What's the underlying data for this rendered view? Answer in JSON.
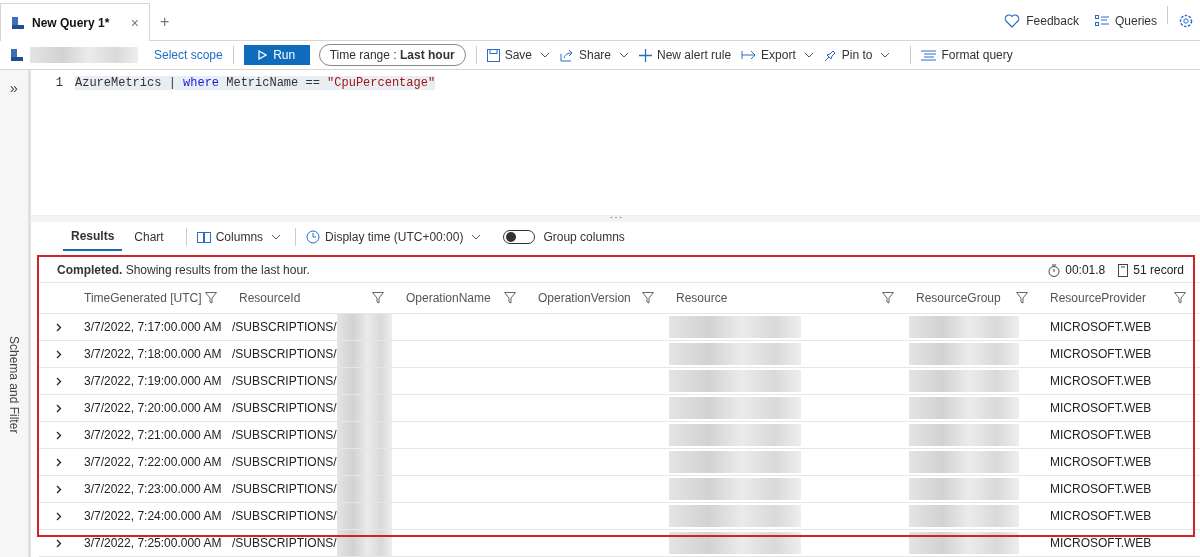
{
  "tabs": [
    {
      "label": "New Query 1*",
      "selected": true,
      "close": "×"
    }
  ],
  "new_tab": "+",
  "header_links": [
    {
      "kind": "feedback",
      "label": "Feedback"
    },
    {
      "kind": "queries",
      "label": "Queries"
    }
  ],
  "toolbar": {
    "scope_link": "Select scope",
    "run": "Run",
    "time_range": {
      "label": "Time range :",
      "value": "Last hour"
    },
    "actions": [
      {
        "kind": "save",
        "label": "Save",
        "dropdown": true
      },
      {
        "kind": "share",
        "label": "Share",
        "dropdown": true
      },
      {
        "kind": "plus",
        "label": "New alert rule",
        "dropdown": false
      },
      {
        "kind": "export",
        "label": "Export",
        "dropdown": true
      },
      {
        "kind": "pin",
        "label": "Pin to",
        "dropdown": true
      },
      {
        "kind": "format",
        "label": "Format query",
        "dropdown": false
      }
    ]
  },
  "side_panel": {
    "toggle": "»",
    "label": "Schema and Filter"
  },
  "editor": {
    "lines": [
      {
        "number": "1",
        "tokens": [
          {
            "text": "AzureMetrics",
            "kind": "plain"
          },
          {
            "text": "|",
            "kind": "plain"
          },
          {
            "text": "where",
            "kind": "keyword"
          },
          {
            "text": "MetricName",
            "kind": "plain"
          },
          {
            "text": "==",
            "kind": "plain"
          },
          {
            "text": "\"CpuPercentage\"",
            "kind": "string"
          }
        ]
      }
    ]
  },
  "results_tabs": [
    {
      "label": "Results",
      "selected": true
    },
    {
      "label": "Chart",
      "selected": false
    }
  ],
  "results_toolbar": {
    "columns": "Columns",
    "display_time": "Display time (UTC+00:00)",
    "group_columns": {
      "label": "Group columns",
      "on": false
    }
  },
  "status": {
    "message": "**Completed.** Showing results from the last hour.",
    "elapsed": "00:01.8",
    "records": "51 record"
  },
  "table": {
    "columns": [
      "TimeGenerated [UTC]",
      "ResourceId",
      "OperationName",
      "OperationVersion",
      "Resource",
      "ResourceGroup",
      "ResourceProvider"
    ],
    "rows": [
      {
        "time": "3/7/2022, 7:17:00.000 AM",
        "resource_id": "/SUBSCRIPTIONS/",
        "provider": "MICROSOFT.WEB",
        "redacted": true
      },
      {
        "time": "3/7/2022, 7:18:00.000 AM",
        "resource_id": "/SUBSCRIPTIONS/",
        "provider": "MICROSOFT.WEB",
        "redacted": true
      },
      {
        "time": "3/7/2022, 7:19:00.000 AM",
        "resource_id": "/SUBSCRIPTIONS/",
        "provider": "MICROSOFT.WEB",
        "redacted": true
      },
      {
        "time": "3/7/2022, 7:20:00.000 AM",
        "resource_id": "/SUBSCRIPTIONS/",
        "provider": "MICROSOFT.WEB",
        "redacted": true
      },
      {
        "time": "3/7/2022, 7:21:00.000 AM",
        "resource_id": "/SUBSCRIPTIONS/",
        "provider": "MICROSOFT.WEB",
        "redacted": true
      },
      {
        "time": "3/7/2022, 7:22:00.000 AM",
        "resource_id": "/SUBSCRIPTIONS/",
        "provider": "MICROSOFT.WEB",
        "redacted": true
      },
      {
        "time": "3/7/2022, 7:23:00.000 AM",
        "resource_id": "/SUBSCRIPTIONS/",
        "provider": "MICROSOFT.WEB",
        "redacted": true
      },
      {
        "time": "3/7/2022, 7:24:00.000 AM",
        "resource_id": "/SUBSCRIPTIONS/",
        "provider": "MICROSOFT.WEB",
        "redacted": true
      },
      {
        "time": "3/7/2022, 7:25:00.000 AM",
        "resource_id": "/SUBSCRIPTIONS/",
        "provider": "MICROSOFT.WEB",
        "redacted": true
      }
    ]
  }
}
